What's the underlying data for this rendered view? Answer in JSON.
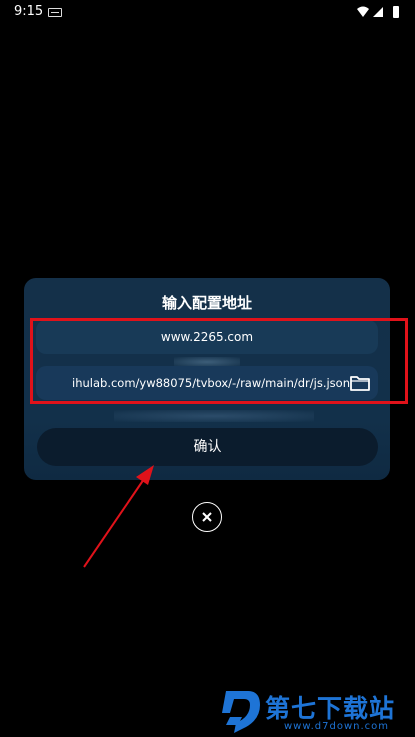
{
  "status_bar": {
    "time": "9:15"
  },
  "dialog": {
    "title": "输入配置地址",
    "name_field_value": "www.2265.com",
    "url_field_value": "ihulab.com/yw88075/tvbox/-/raw/main/dr/js.json",
    "confirm_label": "确认"
  },
  "annotations": {
    "highlight_color": "#e0121a"
  },
  "watermark": {
    "name": "第七下载站",
    "url": "www.d7down.com",
    "color": "#1e74d6"
  }
}
